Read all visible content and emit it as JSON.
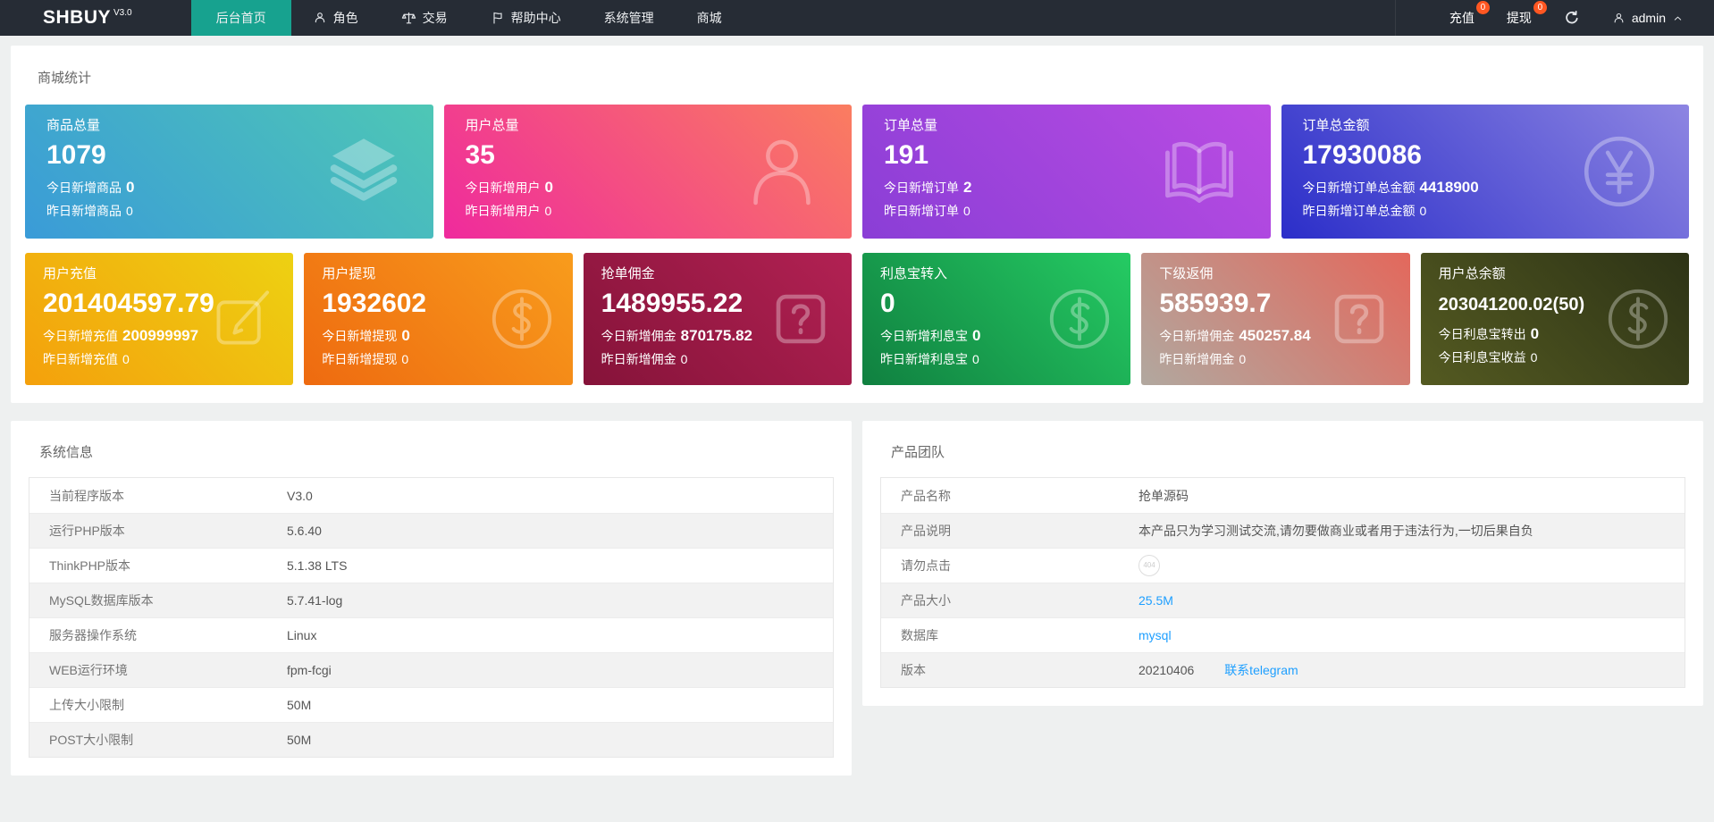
{
  "navbar": {
    "logo": "SHBUY",
    "version": "V3.0",
    "menu": [
      {
        "label": "后台首页"
      },
      {
        "label": "角色"
      },
      {
        "label": "交易"
      },
      {
        "label": "帮助中心"
      },
      {
        "label": "系统管理"
      },
      {
        "label": "商城"
      }
    ],
    "recharge": {
      "label": "充值",
      "badge": "0"
    },
    "withdraw": {
      "label": "提现",
      "badge": "0"
    },
    "user": "admin"
  },
  "colors": {
    "navbar_bg": "#262c35",
    "active_tab": "#17a28f",
    "badge": "#ff5722",
    "link": "#1e9fff"
  },
  "stats": {
    "title": "商城统计",
    "row1": [
      {
        "title": "商品总量",
        "value": "1079",
        "today_label": "今日新增商品",
        "today_value": "0",
        "yesterday_label": "昨日新增商品",
        "yesterday_value": "0",
        "icon": "layers-icon",
        "gradient": [
          "#3a9bd8",
          "#4ec7b5"
        ]
      },
      {
        "title": "用户总量",
        "value": "35",
        "today_label": "今日新增用户",
        "today_value": "0",
        "yesterday_label": "昨日新增用户",
        "yesterday_value": "0",
        "icon": "user-icon",
        "gradient": [
          "#ef2a9d",
          "#fa7d60"
        ]
      },
      {
        "title": "订单总量",
        "value": "191",
        "today_label": "今日新增订单",
        "today_value": "2",
        "yesterday_label": "昨日新增订单",
        "yesterday_value": "0",
        "icon": "book-icon",
        "gradient": [
          "#8a3ed6",
          "#bb4ce3"
        ]
      },
      {
        "title": "订单总金额",
        "value": "17930086",
        "today_label": "今日新增订单总金额",
        "today_value": "4418900",
        "yesterday_label": "昨日新增订单总金额",
        "yesterday_value": "0",
        "icon": "yen-circle-icon",
        "gradient": [
          "#2b2ec9",
          "#8d85e2"
        ]
      }
    ],
    "row2": [
      {
        "title": "用户充值",
        "value": "201404597.79",
        "today_label": "今日新增充值",
        "today_value": "200999997",
        "yesterday_label": "昨日新增充值",
        "yesterday_value": "0",
        "icon": "edit-icon",
        "gradient": [
          "#f4a00c",
          "#edd112"
        ]
      },
      {
        "title": "用户提现",
        "value": "1932602",
        "today_label": "今日新增提现",
        "today_value": "0",
        "yesterday_label": "昨日新增提现",
        "yesterday_value": "0",
        "icon": "dollar-circle-icon",
        "gradient": [
          "#ee6a10",
          "#f89c1c"
        ]
      },
      {
        "title": "抢单佣金",
        "value": "1489955.22",
        "today_label": "今日新增佣金",
        "today_value": "870175.82",
        "yesterday_label": "昨日新增佣金",
        "yesterday_value": "0",
        "icon": "question-box-icon",
        "gradient": [
          "#851339",
          "#b22153"
        ]
      },
      {
        "title": "利息宝转入",
        "value": "0",
        "today_label": "今日新增利息宝",
        "today_value": "0",
        "yesterday_label": "昨日新增利息宝",
        "yesterday_value": "0",
        "icon": "dollar-circle-icon",
        "gradient": [
          "#108040",
          "#25cb63"
        ]
      },
      {
        "title": "下级返佣",
        "value": "585939.7",
        "today_label": "今日新增佣金",
        "today_value": "450257.84",
        "yesterday_label": "昨日新增佣金",
        "yesterday_value": "0",
        "icon": "question-box-icon",
        "gradient": [
          "#b1a89f",
          "#e3685c"
        ]
      },
      {
        "title": "用户总余额",
        "value": "203041200.02(50)",
        "today_label": "今日利息宝转出",
        "today_value": "0",
        "yesterday_label": "今日利息宝收益",
        "yesterday_value": "0",
        "icon": "dollar-circle-icon",
        "gradient": [
          "#545a21",
          "#2d3316"
        ]
      }
    ]
  },
  "system_info": {
    "title": "系统信息",
    "rows": [
      {
        "label": "当前程序版本",
        "value": "V3.0"
      },
      {
        "label": "运行PHP版本",
        "value": "5.6.40"
      },
      {
        "label": "ThinkPHP版本",
        "value": "5.1.38 LTS"
      },
      {
        "label": "MySQL数据库版本",
        "value": "5.7.41-log"
      },
      {
        "label": "服务器操作系统",
        "value": "Linux"
      },
      {
        "label": "WEB运行环境",
        "value": "fpm-fcgi"
      },
      {
        "label": "上传大小限制",
        "value": "50M"
      },
      {
        "label": "POST大小限制",
        "value": "50M"
      }
    ]
  },
  "product_team": {
    "title": "产品团队",
    "rows": [
      {
        "label": "产品名称",
        "value": "抢单源码"
      },
      {
        "label": "产品说明",
        "value": "本产品只为学习测试交流,请勿要做商业或者用于违法行为,一切后果自负"
      },
      {
        "label": "请勿点击",
        "value": "404"
      },
      {
        "label": "产品大小",
        "value": "25.5M"
      },
      {
        "label": "数据库",
        "value": "mysql"
      },
      {
        "label": "版本",
        "value": "20210406",
        "link": "联系telegram"
      }
    ]
  }
}
